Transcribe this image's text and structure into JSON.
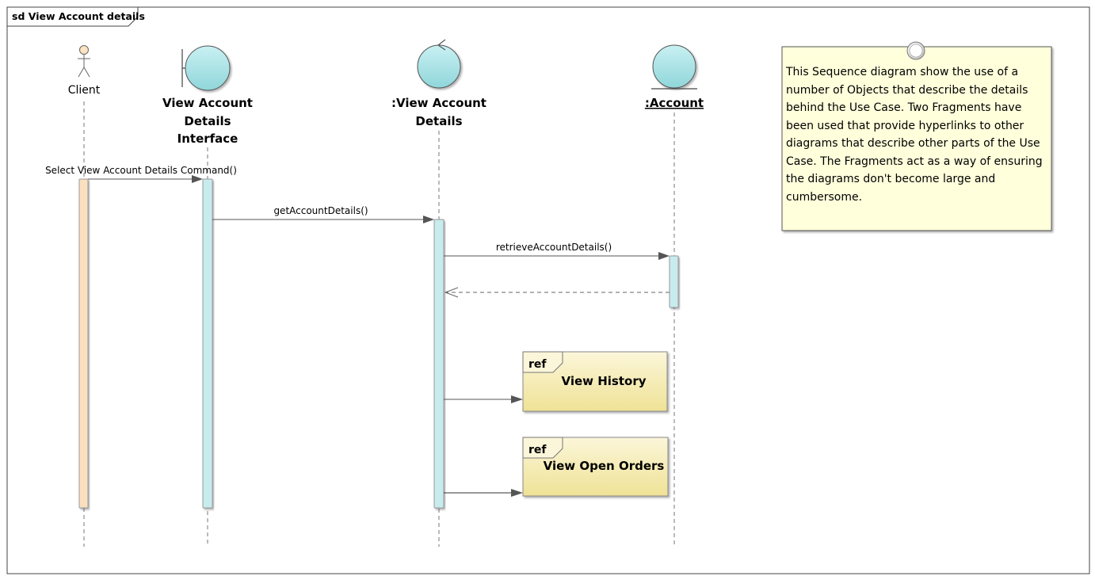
{
  "frame": {
    "title": "sd View Account details"
  },
  "lifelines": [
    {
      "id": "client",
      "kind": "actor",
      "label": "Client"
    },
    {
      "id": "interface",
      "kind": "boundary",
      "label_lines": [
        "View Account",
        "Details",
        "Interface"
      ]
    },
    {
      "id": "control",
      "kind": "control",
      "label_lines": [
        ":View Account",
        "Details"
      ]
    },
    {
      "id": "account",
      "kind": "entity",
      "label": ":Account"
    }
  ],
  "messages": [
    {
      "label": "Select View Account Details Command()",
      "from": "client",
      "to": "interface",
      "kind": "sync"
    },
    {
      "label": "getAccountDetails()",
      "from": "interface",
      "to": "control",
      "kind": "sync"
    },
    {
      "label": "retrieveAccountDetails()",
      "from": "control",
      "to": "account",
      "kind": "sync"
    },
    {
      "label": "",
      "from": "account",
      "to": "control",
      "kind": "return"
    }
  ],
  "fragments": [
    {
      "tag": "ref",
      "title": "View History"
    },
    {
      "tag": "ref",
      "title": "View Open Orders"
    }
  ],
  "note": {
    "text": "This Sequence diagram show the use of a number of Objects that describe the details behind the Use Case. Two Fragments have been used that provide hyperlinks to other diagrams that describe other parts of the Use Case. The Fragments act as a way of ensuring the diagrams don't become large and cumbersome."
  },
  "colors": {
    "object_fill": "#a9e3e6",
    "activation_fill": "#c8ecee",
    "client_activation_fill": "#fbe0c0",
    "actor_head_fill": "#fce4c2",
    "note_fill": "#ffffdc",
    "fragment_fill": "#f3eaa8",
    "line": "#555555"
  }
}
